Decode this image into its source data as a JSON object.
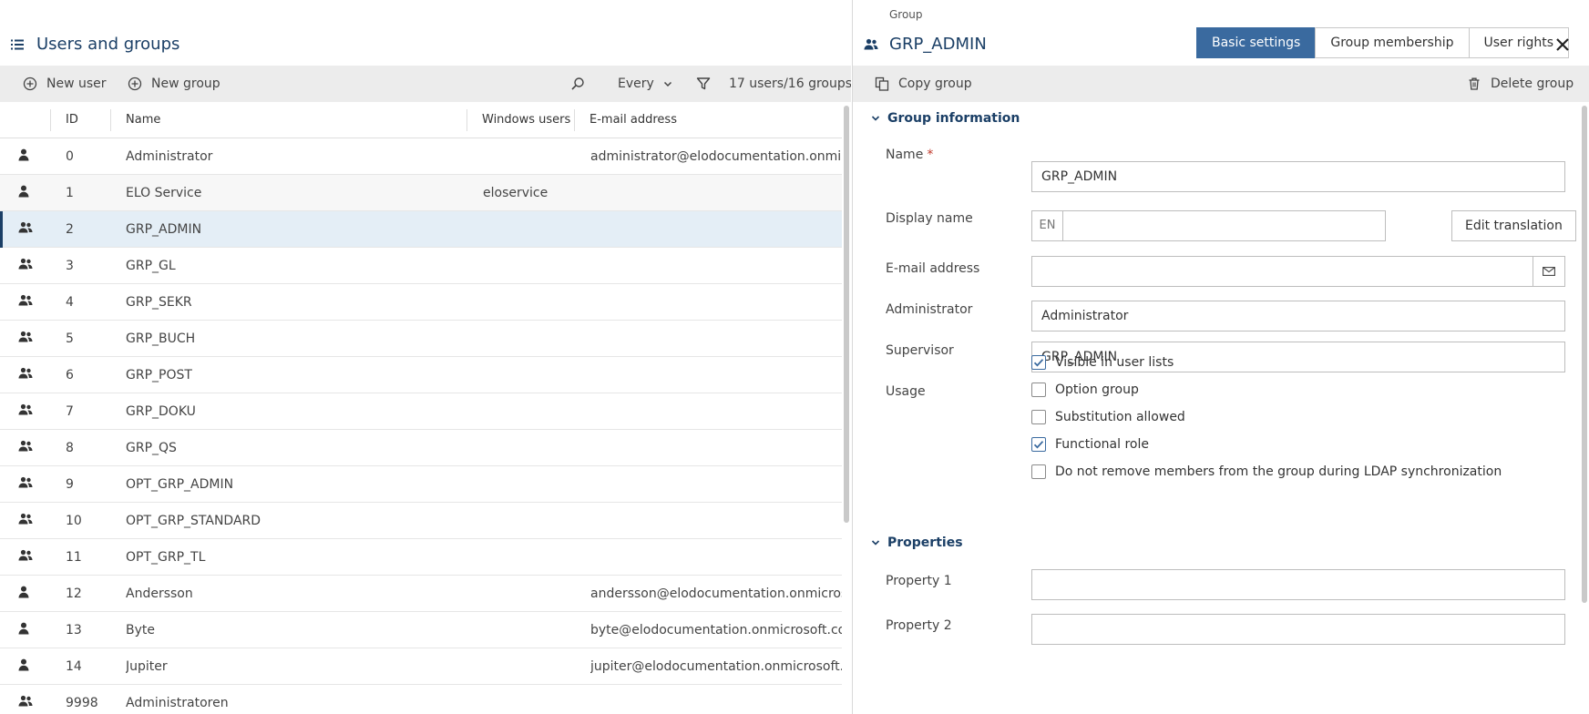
{
  "left_pane": {
    "title": "Users and groups",
    "title_icon": "list-icon",
    "toolbar": {
      "new_user_label": "New user",
      "new_group_label": "New group",
      "filter_select_value": "Every",
      "count_label": "17 users/16 groups"
    },
    "columns": {
      "id": "ID",
      "name": "Name",
      "windows_users": "Windows users",
      "email": "E-mail address"
    },
    "rows": [
      {
        "type": "user",
        "id": "0",
        "name": "Administrator",
        "windows_user": "",
        "email": "administrator@elodocumentation.onmicroso"
      },
      {
        "type": "user",
        "id": "1",
        "name": "ELO Service",
        "windows_user": "eloservice",
        "email": ""
      },
      {
        "type": "group",
        "id": "2",
        "name": "GRP_ADMIN",
        "windows_user": "",
        "email": "",
        "selected": true
      },
      {
        "type": "group",
        "id": "3",
        "name": "GRP_GL",
        "windows_user": "",
        "email": ""
      },
      {
        "type": "group",
        "id": "4",
        "name": "GRP_SEKR",
        "windows_user": "",
        "email": ""
      },
      {
        "type": "group",
        "id": "5",
        "name": "GRP_BUCH",
        "windows_user": "",
        "email": ""
      },
      {
        "type": "group",
        "id": "6",
        "name": "GRP_POST",
        "windows_user": "",
        "email": ""
      },
      {
        "type": "group",
        "id": "7",
        "name": "GRP_DOKU",
        "windows_user": "",
        "email": ""
      },
      {
        "type": "group",
        "id": "8",
        "name": "GRP_QS",
        "windows_user": "",
        "email": ""
      },
      {
        "type": "group",
        "id": "9",
        "name": "OPT_GRP_ADMIN",
        "windows_user": "",
        "email": ""
      },
      {
        "type": "group",
        "id": "10",
        "name": "OPT_GRP_STANDARD",
        "windows_user": "",
        "email": ""
      },
      {
        "type": "group",
        "id": "11",
        "name": "OPT_GRP_TL",
        "windows_user": "",
        "email": ""
      },
      {
        "type": "user",
        "id": "12",
        "name": "Andersson",
        "windows_user": "",
        "email": "andersson@elodocumentation.onmicrosoft.c"
      },
      {
        "type": "user",
        "id": "13",
        "name": "Byte",
        "windows_user": "",
        "email": "byte@elodocumentation.onmicrosoft.com"
      },
      {
        "type": "user",
        "id": "14",
        "name": "Jupiter",
        "windows_user": "",
        "email": "jupiter@elodocumentation.onmicrosoft.com"
      },
      {
        "type": "group",
        "id": "9998",
        "name": "Administratoren",
        "windows_user": "",
        "email": ""
      }
    ]
  },
  "right_pane": {
    "kicker": "Group",
    "title": "GRP_ADMIN",
    "tabs": {
      "basic_settings": "Basic settings",
      "group_membership": "Group membership",
      "user_rights": "User rights",
      "active": "basic_settings"
    },
    "toolbar": {
      "copy_group_label": "Copy group",
      "delete_group_label": "Delete group"
    },
    "group_information": {
      "heading": "Group information",
      "name_label": "Name",
      "required_marker": "*",
      "name_value": "GRP_ADMIN",
      "display_name_label": "Display name",
      "display_name_lang": "EN",
      "display_name_value": "",
      "edit_translation_label": "Edit translation",
      "email_label": "E-mail address",
      "email_value": "",
      "administrator_label": "Administrator",
      "administrator_value": "Administrator",
      "supervisor_label": "Supervisor",
      "supervisor_value": "GRP_ADMIN",
      "usage_label": "Usage",
      "usage_options": [
        {
          "label": "Visible in user lists",
          "checked": true
        },
        {
          "label": "Option group",
          "checked": false
        },
        {
          "label": "Substitution allowed",
          "checked": false
        },
        {
          "label": "Functional role",
          "checked": true
        },
        {
          "label": "Do not remove members from the group during LDAP synchronization",
          "checked": false
        }
      ]
    },
    "properties": {
      "heading": "Properties",
      "property1_label": "Property 1",
      "property1_value": "",
      "property2_label": "Property 2",
      "property2_value": ""
    }
  },
  "colors": {
    "accent": "#1b3f66",
    "tab_active_bg": "#3a6a9f",
    "selection_bg": "#e4eef6",
    "toolbar_bg": "#ececec",
    "required": "#c0392b"
  }
}
